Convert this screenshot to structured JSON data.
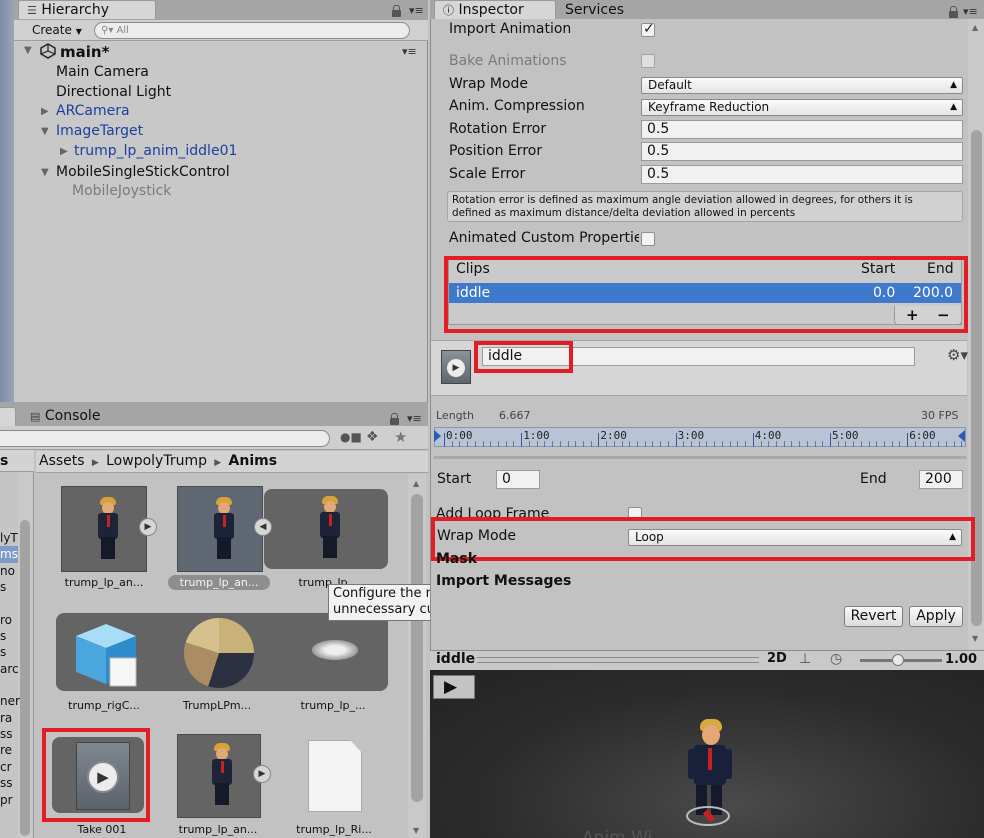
{
  "hierarchy": {
    "tab": "Hierarchy",
    "create_label": "Create",
    "search_placeholder": "All",
    "scene_name": "main*",
    "items": [
      {
        "label": "Main Camera"
      },
      {
        "label": "Directional Light"
      },
      {
        "label": "ARCamera"
      },
      {
        "label": "ImageTarget"
      },
      {
        "label": "trump_lp_anim_iddle01"
      },
      {
        "label": "MobileSingleStickControl"
      },
      {
        "label": "MobileJoystick"
      }
    ]
  },
  "project": {
    "console_tab": "Console",
    "side_letter": "s",
    "breadcrumb": [
      "Assets",
      "LowpolyTrump",
      "Anims"
    ],
    "left_list": [
      "lyT",
      "ms",
      "no",
      "s",
      "",
      "ro",
      "s",
      "s",
      "arc",
      "",
      "ner",
      "ra",
      "ss",
      "re",
      "cr",
      "ss",
      "pr"
    ],
    "assets": [
      {
        "label": "trump_lp_an..."
      },
      {
        "label": "trump_lp_an..."
      },
      {
        "label": "trump_lp_..."
      },
      {
        "label": "trump_rigC..."
      },
      {
        "label": "TrumpLPm..."
      },
      {
        "label": "trump_lp_..."
      },
      {
        "label": "Take 001"
      },
      {
        "label": "trump_lp_an..."
      },
      {
        "label": "trump_lp_Ri..."
      }
    ]
  },
  "tooltip": {
    "line1": "Configure the mask for this clip to remove",
    "line2": "unnecessary curves."
  },
  "inspector": {
    "tab": "Inspector",
    "tab2": "Services",
    "import_animation": "Import Animation",
    "import_animation_checked": true,
    "bake_animations": "Bake Animations",
    "wrap_mode_label": "Wrap Mode",
    "wrap_mode_value": "Default",
    "anim_compression_label": "Anim. Compression",
    "anim_compression_value": "Keyframe Reduction",
    "rotation_error_label": "Rotation Error",
    "rotation_error_value": "0.5",
    "position_error_label": "Position Error",
    "position_error_value": "0.5",
    "scale_error_label": "Scale Error",
    "scale_error_value": "0.5",
    "help_line1": "Rotation error is defined as maximum angle deviation allowed in degrees, for others it is",
    "help_line2": "defined as maximum distance/delta deviation allowed in percents",
    "animated_custom_props": "Animated Custom Properties",
    "clips": {
      "header_clips": "Clips",
      "header_start": "Start",
      "header_end": "End",
      "rows": [
        {
          "name": "iddle",
          "start": "0.0",
          "end": "200.0"
        }
      ],
      "add": "+",
      "remove": "−"
    },
    "clip_name": "iddle",
    "length_label": "Length",
    "length_value": "6.667",
    "fps": "30 FPS",
    "timeline_labels": [
      "0:00",
      "1:00",
      "2:00",
      "3:00",
      "4:00",
      "5:00",
      "6:00"
    ],
    "start_label": "Start",
    "start_value": "0",
    "end_label": "End",
    "end_value": "200",
    "add_loop_frame": "Add Loop Frame",
    "clip_wrap_mode_label": "Wrap Mode",
    "clip_wrap_mode_value": "Loop",
    "mask_label": "Mask",
    "import_messages_label": "Import Messages",
    "revert": "Revert",
    "apply": "Apply"
  },
  "preview": {
    "title": "iddle",
    "mode_2d": "2D",
    "speed": "1.00",
    "bottom_text": "Anim Wi..."
  }
}
